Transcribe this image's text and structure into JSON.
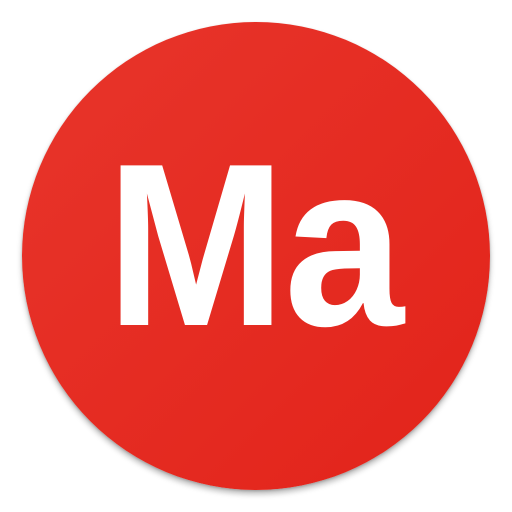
{
  "logo": {
    "text": "Ma",
    "colors": {
      "background_light": "#e8352b",
      "background_dark": "#e2231a",
      "text": "#ffffff"
    }
  }
}
